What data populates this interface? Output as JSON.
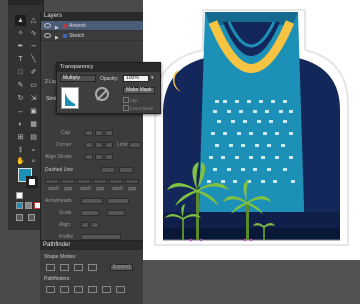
{
  "layers_panel": {
    "tab": "Layers",
    "layers": [
      {
        "name": "Artwork",
        "selected": true,
        "color": "#b23b3b"
      },
      {
        "name": "Sketch",
        "selected": false,
        "color": "#3b67b2"
      }
    ]
  },
  "stroke_panel": {
    "tab_fragment": "Strok",
    "layer_fragment": "2 Laye",
    "cap_label": "Cap",
    "corner_label": "Corner",
    "limit_label": "Limit",
    "align_label": "Align Stroke",
    "dashed_label": "Dashed Line",
    "dash_labels": [
      "dash",
      "gap",
      "dash",
      "gap",
      "dash",
      "gap"
    ],
    "arrowheads_label": "Arrowheads",
    "scale_label": "Scale",
    "align2_label": "Align",
    "profile_label": "Profile"
  },
  "transparency_panel": {
    "tab": "Transparency",
    "blend_mode": "Multiply",
    "opacity_label": "Opacity:",
    "opacity_value": "100%",
    "make_mask_label": "Make Mask",
    "clip_label": "Clip",
    "invert_mask_label": "Invert Mask"
  },
  "pathfinder_panel": {
    "tab": "Pathfinder",
    "shape_modes_label": "Shape Modes:",
    "expand_label": "Expand",
    "pathfinders_label": "Pathfinders:"
  },
  "colors": {
    "fill": "#1d90b7",
    "accent_selection": "#4a5c78",
    "sky_dark": "#14275a",
    "building_blue": "#1d90b7",
    "arch_yellow": "#f7c342",
    "palm_green": "#7ec143"
  }
}
